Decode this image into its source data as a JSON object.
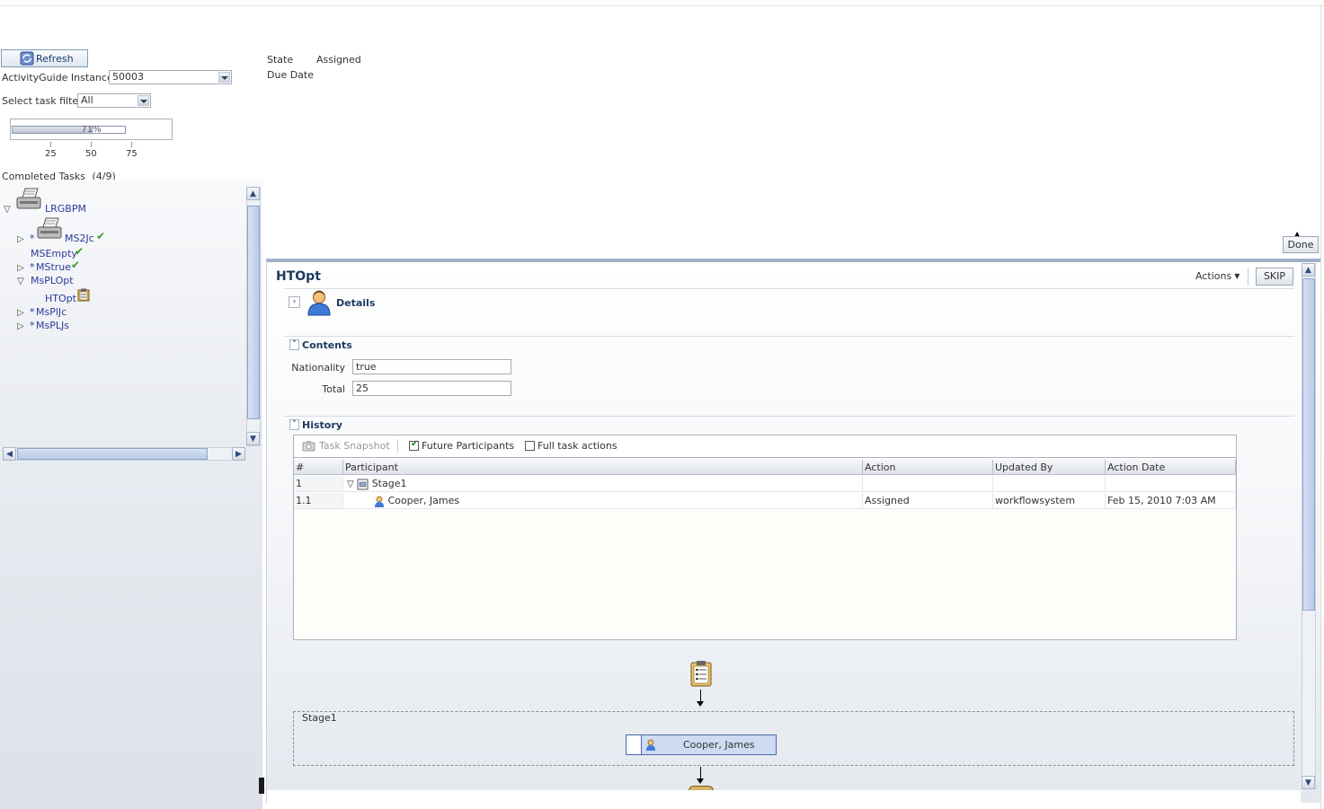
{
  "toolbar": {
    "refresh_label": "Refresh"
  },
  "instances": {
    "label": "ActivityGuide Instances",
    "value": "50003"
  },
  "task_filter": {
    "label": "Select task filter",
    "value": "All"
  },
  "progress": {
    "value_percent": 71,
    "text": "71%",
    "ticks": [
      "25",
      "50",
      "75"
    ]
  },
  "completed": {
    "label": "Completed Tasks",
    "count": "(4/9)"
  },
  "tree": {
    "root": "LRGBPM",
    "items": [
      {
        "prefix": "*",
        "label": "MS2Jc"
      },
      {
        "prefix": "",
        "label": "MSEmpty"
      },
      {
        "prefix": "*",
        "label": "MStrue"
      },
      {
        "prefix": "",
        "label": "MsPLOpt"
      },
      {
        "prefix": "",
        "label": "HTOpt"
      },
      {
        "prefix": "*",
        "label": "MsPlJc"
      },
      {
        "prefix": "*",
        "label": "MsPLJs"
      }
    ]
  },
  "header": {
    "state_label": "State",
    "state_value": "Assigned",
    "due_date_label": "Due Date"
  },
  "done_label": "Done",
  "task": {
    "title": "HTOpt",
    "actions_label": "Actions",
    "skip_label": "SKIP",
    "details_label": "Details",
    "contents_label": "Contents",
    "fields": [
      {
        "label": "Nationality",
        "value": "true"
      },
      {
        "label": "Total",
        "value": "25"
      }
    ],
    "history": {
      "label": "History",
      "task_snapshot": "Task Snapshot",
      "future_participants": "Future Participants",
      "full_task_actions": "Full task actions",
      "columns": [
        "#",
        "Participant",
        "Action",
        "Updated By",
        "Action Date"
      ],
      "rows": [
        {
          "num": "1",
          "participant": "Stage1",
          "action": "",
          "updated_by": "",
          "action_date": ""
        },
        {
          "num": "1.1",
          "participant": "Cooper, James",
          "action": "Assigned",
          "updated_by": "workflowsystem",
          "action_date": "Feb 15, 2010 7:03 AM"
        }
      ]
    },
    "diagram": {
      "stage_label": "Stage1",
      "assignee": "Cooper, James"
    }
  }
}
